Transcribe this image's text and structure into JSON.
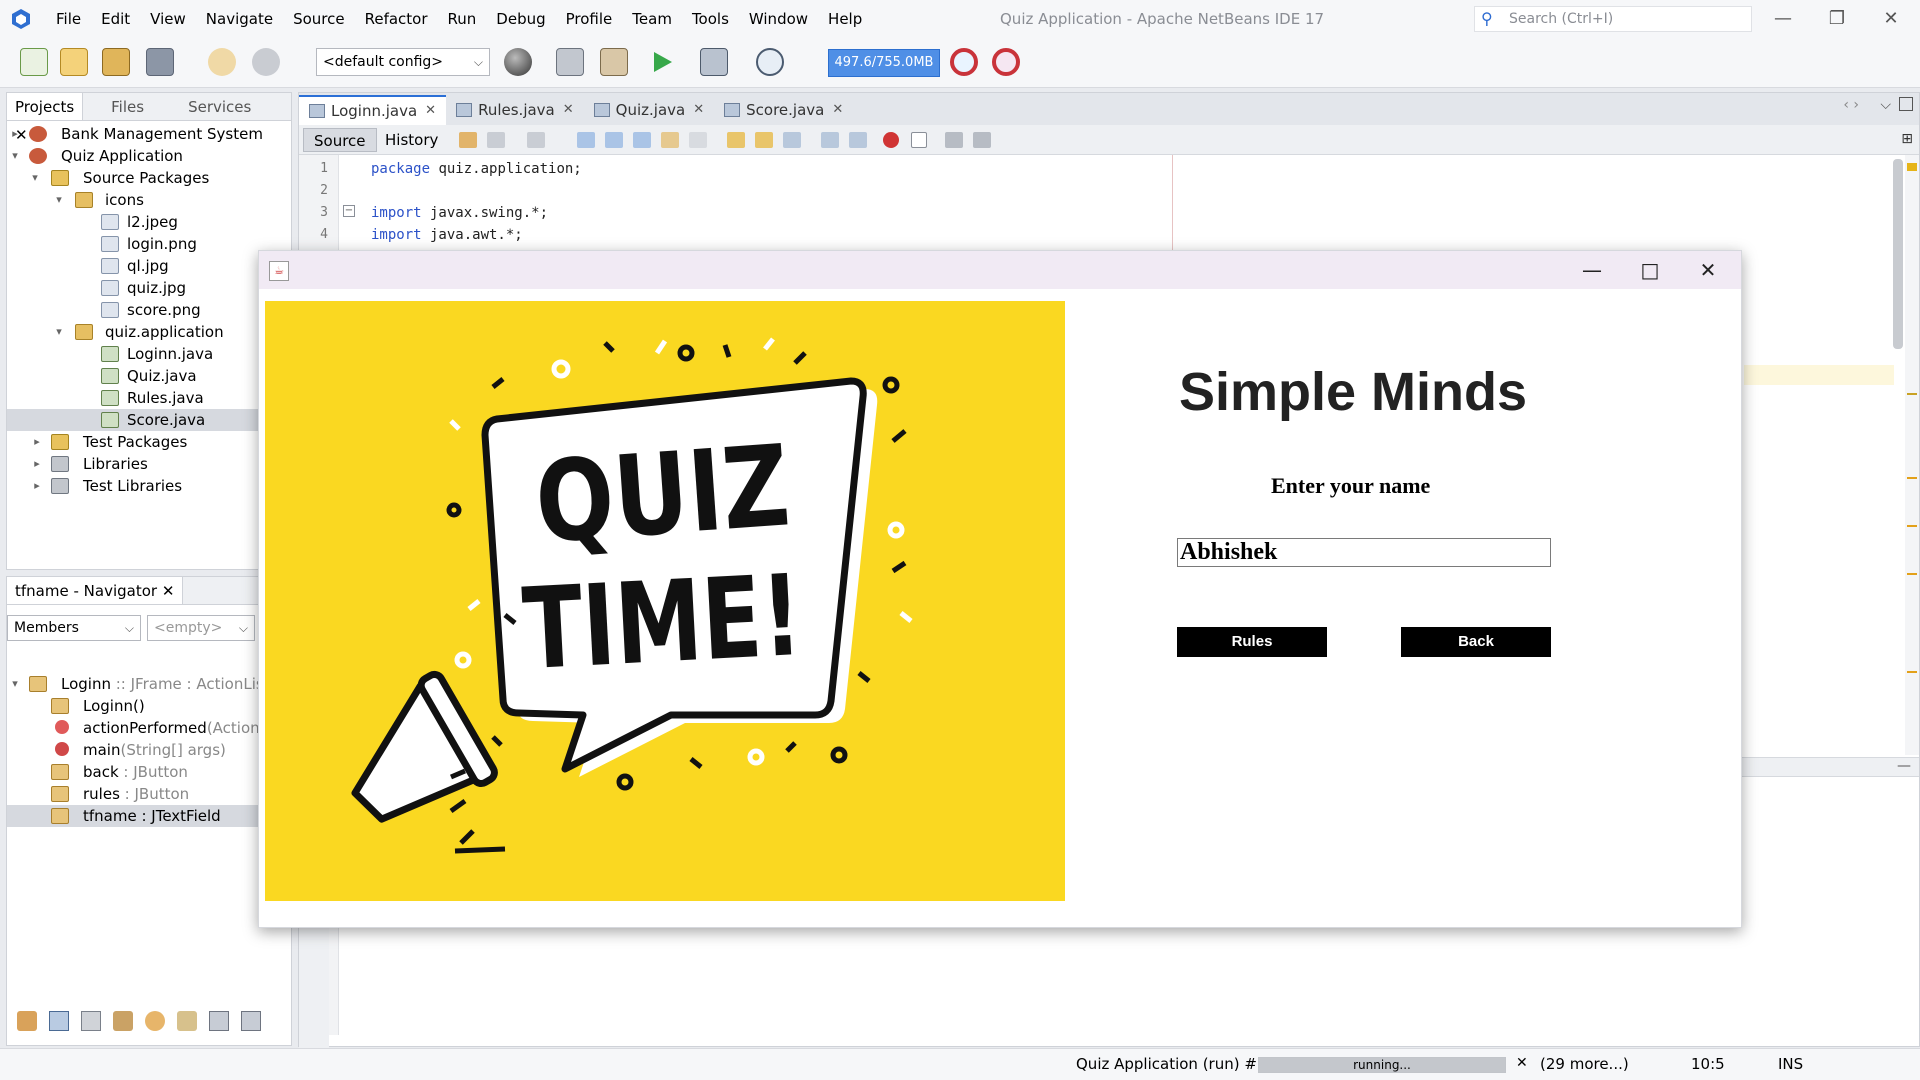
{
  "menu": [
    "File",
    "Edit",
    "View",
    "Navigate",
    "Source",
    "Refactor",
    "Run",
    "Debug",
    "Profile",
    "Team",
    "Tools",
    "Window",
    "Help"
  ],
  "ide_title": "Quiz Application - Apache NetBeans IDE 17",
  "search_placeholder": "Search (Ctrl+I)",
  "toolbar": {
    "config": "<default config>",
    "memory": "497.6/755.0MB"
  },
  "projects_panel": {
    "tabs": [
      "Projects",
      "Files",
      "Services"
    ],
    "tree": [
      "Bank Management System",
      "Quiz Application",
      "Source Packages",
      "icons",
      "l2.jpeg",
      "login.png",
      "ql.jpg",
      "quiz.jpg",
      "score.png",
      "quiz.application",
      "Loginn.java",
      "Quiz.java",
      "Rules.java",
      "Score.java",
      "Test Packages",
      "Libraries",
      "Test Libraries"
    ]
  },
  "navigator": {
    "title": "tfname - Navigator",
    "members_select": "Members",
    "filter_select": "<empty>",
    "items": [
      {
        "name": "Loginn",
        "type": " :: JFrame : ActionListener"
      },
      {
        "name": "Loginn()",
        "type": ""
      },
      {
        "name": "actionPerformed",
        "type": "(ActionEvent"
      },
      {
        "name": "main",
        "type": "(String[] args)"
      },
      {
        "name": "back",
        "type": " : JButton"
      },
      {
        "name": "rules",
        "type": " : JButton"
      },
      {
        "name": "tfname : JTextField",
        "type": ""
      }
    ]
  },
  "editor": {
    "tabs": [
      "Loginn.java",
      "Rules.java",
      "Quiz.java",
      "Score.java"
    ],
    "views": [
      "Source",
      "History"
    ],
    "lines": [
      {
        "n": "1",
        "kw": "package",
        "rest": " quiz.application;"
      },
      {
        "n": "2",
        "kw": "",
        "rest": ""
      },
      {
        "n": "3",
        "kw": "import",
        "rest": " javax.swing.*;"
      },
      {
        "n": "4",
        "kw": "import",
        "rest": " java.awt.*;"
      }
    ]
  },
  "status": {
    "run": "Quiz Application (run) #30",
    "progress_text": "running...",
    "progress_fraction": 1.0,
    "more": "(29 more...)",
    "position": "10:5",
    "mode": "INS"
  },
  "app_window": {
    "image_text": [
      "QUIZ",
      "TIME!"
    ],
    "title": "Simple Minds",
    "name_label": "Enter your name",
    "name_value": "Abhishek",
    "rules_button": "Rules",
    "back_button": "Back"
  }
}
